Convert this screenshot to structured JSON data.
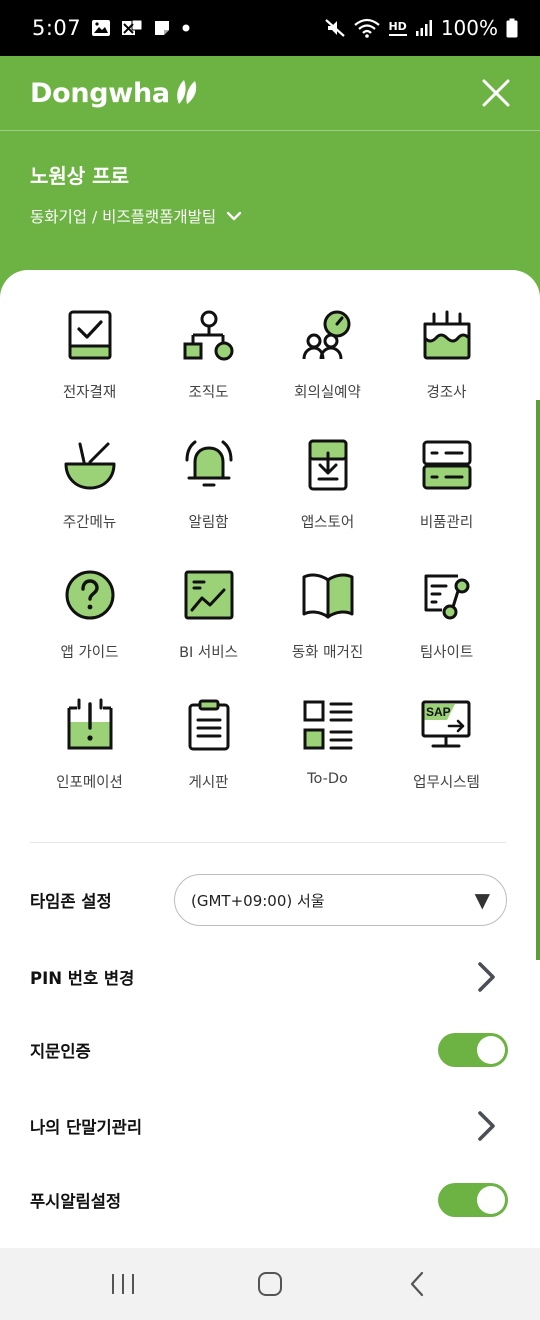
{
  "status_bar": {
    "time": "5:07",
    "hd_label": "HD",
    "battery_text": "100%"
  },
  "header": {
    "logo_text": "Dongwha",
    "close_icon": "close-icon"
  },
  "profile": {
    "name": "노원상 프로",
    "org": "동화기업 / 비즈플랫폼개발팀"
  },
  "menu": {
    "items": [
      {
        "label": "전자결재",
        "icon": "approval-icon"
      },
      {
        "label": "조직도",
        "icon": "org-chart-icon"
      },
      {
        "label": "회의실예약",
        "icon": "meeting-room-icon"
      },
      {
        "label": "경조사",
        "icon": "cake-icon"
      },
      {
        "label": "주간메뉴",
        "icon": "bowl-icon"
      },
      {
        "label": "알림함",
        "icon": "bell-icon"
      },
      {
        "label": "앱스토어",
        "icon": "download-icon"
      },
      {
        "label": "비품관리",
        "icon": "cabinet-icon"
      },
      {
        "label": "앱 가이드",
        "icon": "question-icon"
      },
      {
        "label": "BI 서비스",
        "icon": "chart-icon"
      },
      {
        "label": "동화 매거진",
        "icon": "book-icon"
      },
      {
        "label": "팀사이트",
        "icon": "team-site-icon"
      },
      {
        "label": "인포메이션",
        "icon": "info-board-icon"
      },
      {
        "label": "게시판",
        "icon": "clipboard-icon"
      },
      {
        "label": "To-Do",
        "icon": "todo-list-icon"
      },
      {
        "label": "업무시스템",
        "icon": "sap-monitor-icon",
        "icon_text": "SAP"
      }
    ]
  },
  "settings": {
    "timezone": {
      "label": "타임존 설정",
      "value": "(GMT+09:00) 서울"
    },
    "pin": {
      "label": "PIN 번호 변경"
    },
    "fingerprint": {
      "label": "지문인증",
      "enabled": true
    },
    "devices": {
      "label": "나의 단말기관리"
    },
    "push": {
      "label": "푸시알림설정",
      "enabled": true
    }
  },
  "colors": {
    "brand_green": "#6db344",
    "icon_green": "#9bd177",
    "panel_bg": "#ffffff",
    "nav_bg": "#f2f2f2"
  }
}
